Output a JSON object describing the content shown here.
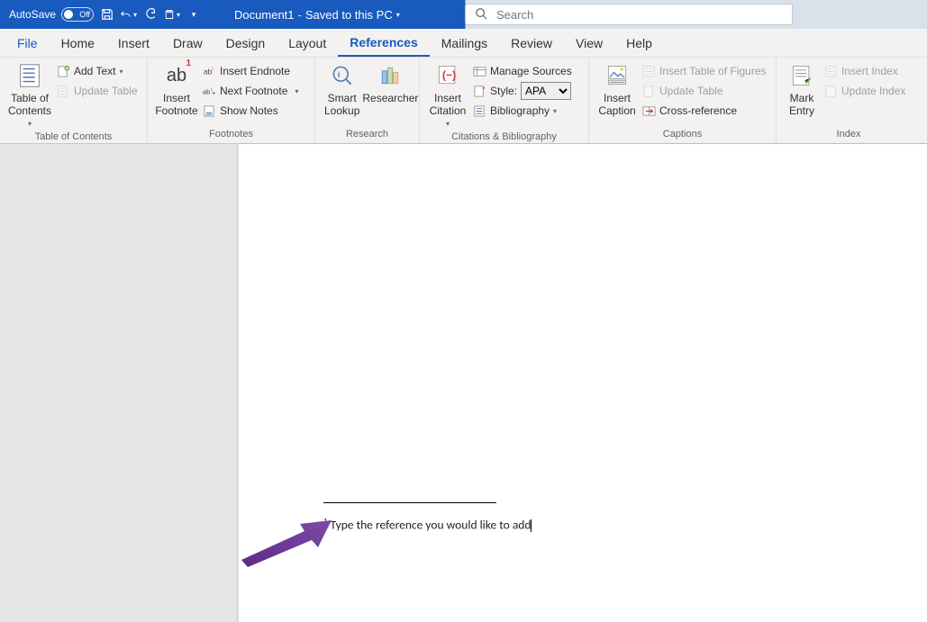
{
  "titlebar": {
    "autosave_label": "AutoSave",
    "autosave_state": "Off",
    "doc_name": "Document1",
    "doc_sep": "-",
    "doc_status": "Saved to this PC"
  },
  "search": {
    "placeholder": "Search"
  },
  "menu": {
    "file": "File",
    "home": "Home",
    "insert": "Insert",
    "draw": "Draw",
    "design": "Design",
    "layout": "Layout",
    "references": "References",
    "mailings": "Mailings",
    "review": "Review",
    "view": "View",
    "help": "Help"
  },
  "ribbon": {
    "toc": {
      "group": "Table of Contents",
      "big": "Table of\nContents",
      "add_text": "Add Text",
      "update_table": "Update Table"
    },
    "footnotes": {
      "group": "Footnotes",
      "insert_footnote": "Insert\nFootnote",
      "insert_endnote": "Insert Endnote",
      "next_footnote": "Next Footnote",
      "show_notes": "Show Notes"
    },
    "research": {
      "group": "Research",
      "smart_lookup": "Smart\nLookup",
      "researcher": "Researcher"
    },
    "citations": {
      "group": "Citations & Bibliography",
      "insert_citation": "Insert\nCitation",
      "manage_sources": "Manage Sources",
      "style_label": "Style:",
      "style_value": "APA",
      "bibliography": "Bibliography"
    },
    "captions": {
      "group": "Captions",
      "insert_caption": "Insert\nCaption",
      "insert_tof": "Insert Table of Figures",
      "update_table": "Update Table",
      "cross_reference": "Cross-reference"
    },
    "index": {
      "group": "Index",
      "mark_entry": "Mark\nEntry",
      "insert_index": "Insert Index",
      "update_index": "Update Index"
    }
  },
  "document": {
    "footnote_text": "Type the reference you would like to add"
  }
}
